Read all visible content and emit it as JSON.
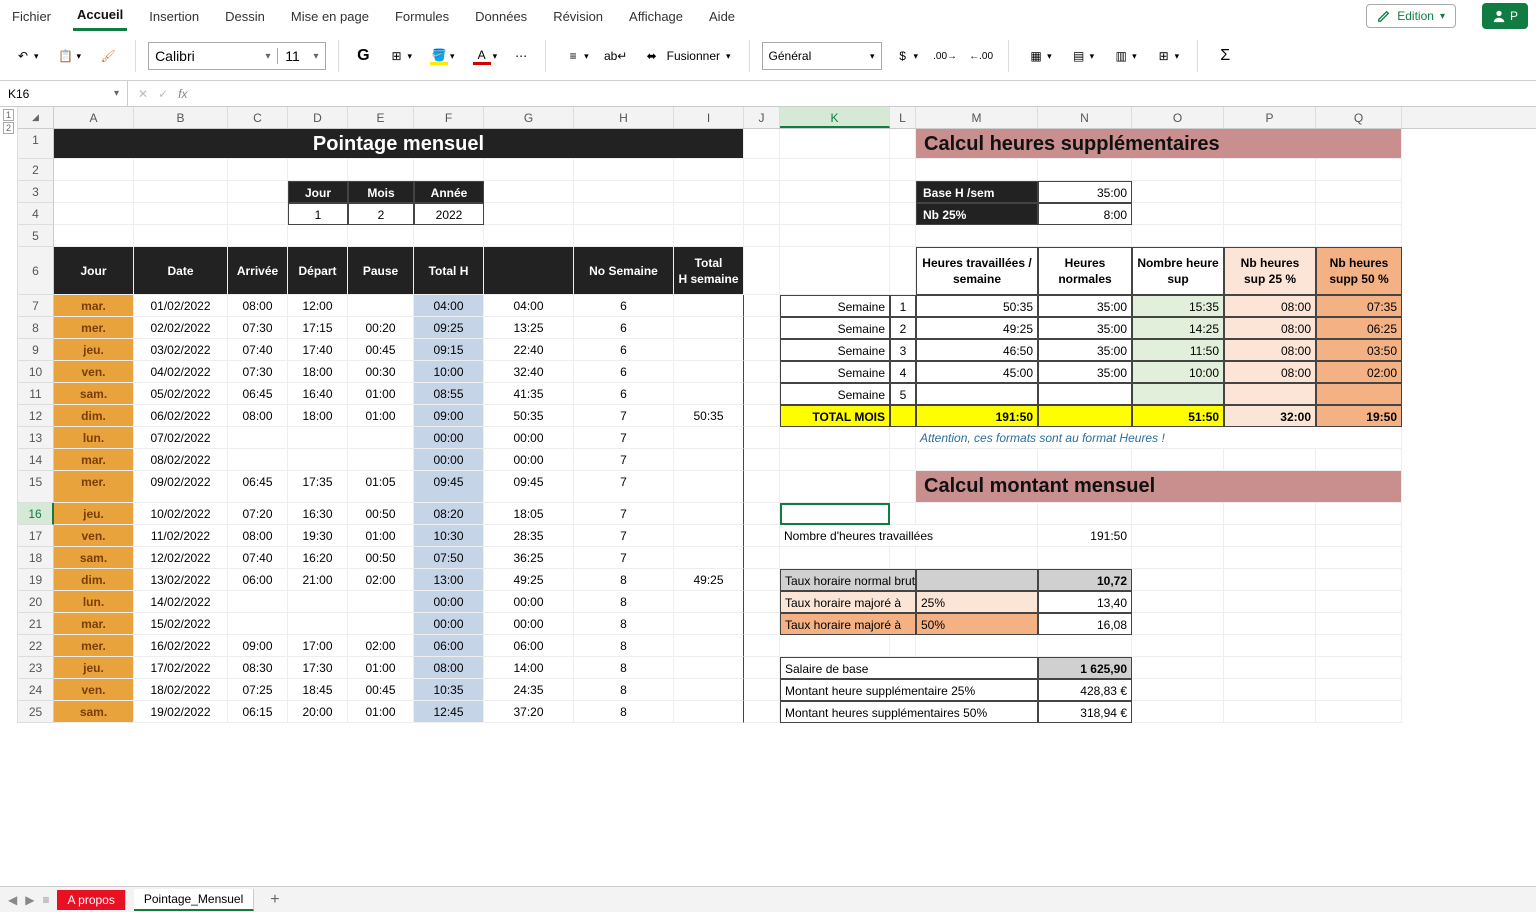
{
  "menu": {
    "file": "Fichier",
    "home": "Accueil",
    "insert": "Insertion",
    "draw": "Dessin",
    "layout": "Mise en page",
    "formulas": "Formules",
    "data": "Données",
    "review": "Révision",
    "view": "Affichage",
    "help": "Aide",
    "edit": "Edition",
    "share": "P"
  },
  "toolbar": {
    "font": "Calibri",
    "size": "11",
    "numfmt": "Général",
    "merge": "Fusionner"
  },
  "fbar": {
    "ref": "K16",
    "fx": "fx"
  },
  "cols": [
    "A",
    "B",
    "C",
    "D",
    "E",
    "F",
    "G",
    "H",
    "I",
    "J",
    "K",
    "L",
    "M",
    "N",
    "O",
    "P",
    "Q"
  ],
  "title": "Pointage mensuel",
  "dateHdr": {
    "jour": "Jour",
    "mois": "Mois",
    "annee": "Année",
    "j": "1",
    "m": "2",
    "a": "2022"
  },
  "colHdrs": {
    "jour": "Jour",
    "date": "Date",
    "arrivee": "Arrivée",
    "depart": "Départ",
    "pause": "Pause",
    "totalh": "Total H",
    "nosem": "No Semaine",
    "totalhsem": "Total H semaine"
  },
  "calcTitle": "Calcul heures supplémentaires",
  "calc2Title": "Calcul montant mensuel",
  "baseH": {
    "label": "Base H /sem",
    "val": "35:00"
  },
  "nb25": {
    "label": "Nb 25%",
    "val": "8:00"
  },
  "calcHdrs": {
    "ht": "Heures travaillées / semaine",
    "hn": "Heures normales",
    "nhs": "Nombre heure sup",
    "s25": "Nb heures sup 25 %",
    "s50": "Nb heures supp 50 %"
  },
  "weeks": [
    {
      "lab": "Semaine",
      "n": "1",
      "ht": "50:35",
      "hn": "35:00",
      "nhs": "15:35",
      "s25": "08:00",
      "s50": "07:35"
    },
    {
      "lab": "Semaine",
      "n": "2",
      "ht": "49:25",
      "hn": "35:00",
      "nhs": "14:25",
      "s25": "08:00",
      "s50": "06:25"
    },
    {
      "lab": "Semaine",
      "n": "3",
      "ht": "46:50",
      "hn": "35:00",
      "nhs": "11:50",
      "s25": "08:00",
      "s50": "03:50"
    },
    {
      "lab": "Semaine",
      "n": "4",
      "ht": "45:00",
      "hn": "35:00",
      "nhs": "10:00",
      "s25": "08:00",
      "s50": "02:00"
    },
    {
      "lab": "Semaine",
      "n": "5",
      "ht": "",
      "hn": "",
      "nhs": "",
      "s25": "",
      "s50": ""
    }
  ],
  "totalMois": {
    "lab": "TOTAL MOIS",
    "ht": "191:50",
    "nhs": "51:50",
    "s25": "32:00",
    "s50": "19:50"
  },
  "note": "Attention, ces formats sont au format Heures !",
  "nhTrav": {
    "lab": "Nombre d'heures travaillées",
    "val": "191:50"
  },
  "taux": [
    {
      "lab": "Taux horaire normal brut :",
      "pct": "",
      "val": "10,72",
      "cls": "gray-cell"
    },
    {
      "lab": "Taux horaire majoré à",
      "pct": "25%",
      "val": "13,40",
      "cls": "peach"
    },
    {
      "lab": "Taux horaire majoré à",
      "pct": "50%",
      "val": "16,08",
      "cls": "orange"
    }
  ],
  "salaire": [
    {
      "lab": "Salaire de base",
      "val": "1 625,90",
      "cls": "gray-cell bold"
    },
    {
      "lab": "Montant heure supplémentaire 25%",
      "val": "428,83 €",
      "cls": ""
    },
    {
      "lab": "Montant heures supplémentaires 50%",
      "val": "318,94 €",
      "cls": ""
    }
  ],
  "log": [
    {
      "r": 7,
      "day": "mar.",
      "date": "01/02/2022",
      "arr": "08:00",
      "dep": "12:00",
      "pau": "",
      "th": "04:00",
      "cum": "04:00",
      "ns": "6",
      "ths": ""
    },
    {
      "r": 8,
      "day": "mer.",
      "date": "02/02/2022",
      "arr": "07:30",
      "dep": "17:15",
      "pau": "00:20",
      "th": "09:25",
      "cum": "13:25",
      "ns": "6",
      "ths": ""
    },
    {
      "r": 9,
      "day": "jeu.",
      "date": "03/02/2022",
      "arr": "07:40",
      "dep": "17:40",
      "pau": "00:45",
      "th": "09:15",
      "cum": "22:40",
      "ns": "6",
      "ths": ""
    },
    {
      "r": 10,
      "day": "ven.",
      "date": "04/02/2022",
      "arr": "07:30",
      "dep": "18:00",
      "pau": "00:30",
      "th": "10:00",
      "cum": "32:40",
      "ns": "6",
      "ths": ""
    },
    {
      "r": 11,
      "day": "sam.",
      "date": "05/02/2022",
      "arr": "06:45",
      "dep": "16:40",
      "pau": "01:00",
      "th": "08:55",
      "cum": "41:35",
      "ns": "6",
      "ths": ""
    },
    {
      "r": 12,
      "day": "dim.",
      "date": "06/02/2022",
      "arr": "08:00",
      "dep": "18:00",
      "pau": "01:00",
      "th": "09:00",
      "cum": "50:35",
      "ns": "7",
      "ths": "50:35"
    },
    {
      "r": 13,
      "day": "lun.",
      "date": "07/02/2022",
      "arr": "",
      "dep": "",
      "pau": "",
      "th": "00:00",
      "cum": "00:00",
      "ns": "7",
      "ths": ""
    },
    {
      "r": 14,
      "day": "mar.",
      "date": "08/02/2022",
      "arr": "",
      "dep": "",
      "pau": "",
      "th": "00:00",
      "cum": "00:00",
      "ns": "7",
      "ths": ""
    },
    {
      "r": 15,
      "day": "mer.",
      "date": "09/02/2022",
      "arr": "06:45",
      "dep": "17:35",
      "pau": "01:05",
      "th": "09:45",
      "cum": "09:45",
      "ns": "7",
      "ths": ""
    },
    {
      "r": 16,
      "day": "jeu.",
      "date": "10/02/2022",
      "arr": "07:20",
      "dep": "16:30",
      "pau": "00:50",
      "th": "08:20",
      "cum": "18:05",
      "ns": "7",
      "ths": ""
    },
    {
      "r": 17,
      "day": "ven.",
      "date": "11/02/2022",
      "arr": "08:00",
      "dep": "19:30",
      "pau": "01:00",
      "th": "10:30",
      "cum": "28:35",
      "ns": "7",
      "ths": ""
    },
    {
      "r": 18,
      "day": "sam.",
      "date": "12/02/2022",
      "arr": "07:40",
      "dep": "16:20",
      "pau": "00:50",
      "th": "07:50",
      "cum": "36:25",
      "ns": "7",
      "ths": ""
    },
    {
      "r": 19,
      "day": "dim.",
      "date": "13/02/2022",
      "arr": "06:00",
      "dep": "21:00",
      "pau": "02:00",
      "th": "13:00",
      "cum": "49:25",
      "ns": "8",
      "ths": "49:25"
    },
    {
      "r": 20,
      "day": "lun.",
      "date": "14/02/2022",
      "arr": "",
      "dep": "",
      "pau": "",
      "th": "00:00",
      "cum": "00:00",
      "ns": "8",
      "ths": ""
    },
    {
      "r": 21,
      "day": "mar.",
      "date": "15/02/2022",
      "arr": "",
      "dep": "",
      "pau": "",
      "th": "00:00",
      "cum": "00:00",
      "ns": "8",
      "ths": ""
    },
    {
      "r": 22,
      "day": "mer.",
      "date": "16/02/2022",
      "arr": "09:00",
      "dep": "17:00",
      "pau": "02:00",
      "th": "06:00",
      "cum": "06:00",
      "ns": "8",
      "ths": ""
    },
    {
      "r": 23,
      "day": "jeu.",
      "date": "17/02/2022",
      "arr": "08:30",
      "dep": "17:30",
      "pau": "01:00",
      "th": "08:00",
      "cum": "14:00",
      "ns": "8",
      "ths": ""
    },
    {
      "r": 24,
      "day": "ven.",
      "date": "18/02/2022",
      "arr": "07:25",
      "dep": "18:45",
      "pau": "00:45",
      "th": "10:35",
      "cum": "24:35",
      "ns": "8",
      "ths": ""
    },
    {
      "r": 25,
      "day": "sam.",
      "date": "19/02/2022",
      "arr": "06:15",
      "dep": "20:00",
      "pau": "01:00",
      "th": "12:45",
      "cum": "37:20",
      "ns": "8",
      "ths": ""
    }
  ],
  "sheets": {
    "s1": "A propos",
    "s2": "Pointage_Mensuel"
  }
}
